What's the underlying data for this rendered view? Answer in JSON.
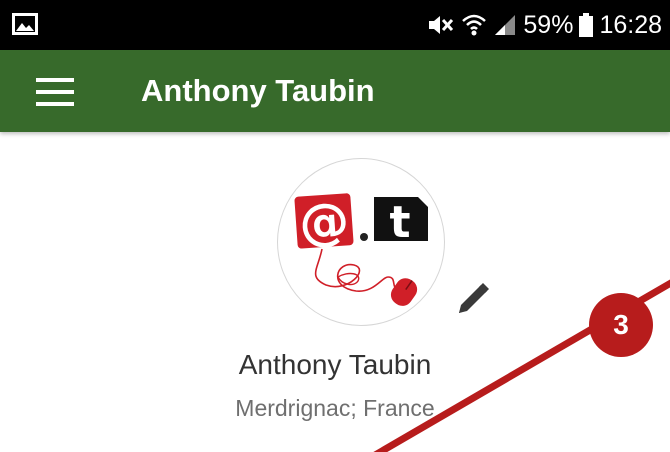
{
  "status_bar": {
    "battery": "59%",
    "time": "16:28"
  },
  "app_bar": {
    "title": "Anthony Taubin"
  },
  "profile": {
    "name": "Anthony Taubin",
    "location": "Merdrignac; France",
    "avatar_logo_text": "@.t"
  },
  "annotation": {
    "badge": "3",
    "color": "#b71c1c"
  },
  "colors": {
    "app_bar": "#376a2b",
    "status_bar": "#000000",
    "logo_red": "#d01f28"
  },
  "icons": {
    "status_left": "image-icon",
    "mute": "mute-icon",
    "wifi": "wifi-icon",
    "signal": "signal-icon",
    "battery": "battery-icon",
    "menu": "hamburger-menu-icon",
    "edit": "pencil-icon"
  }
}
